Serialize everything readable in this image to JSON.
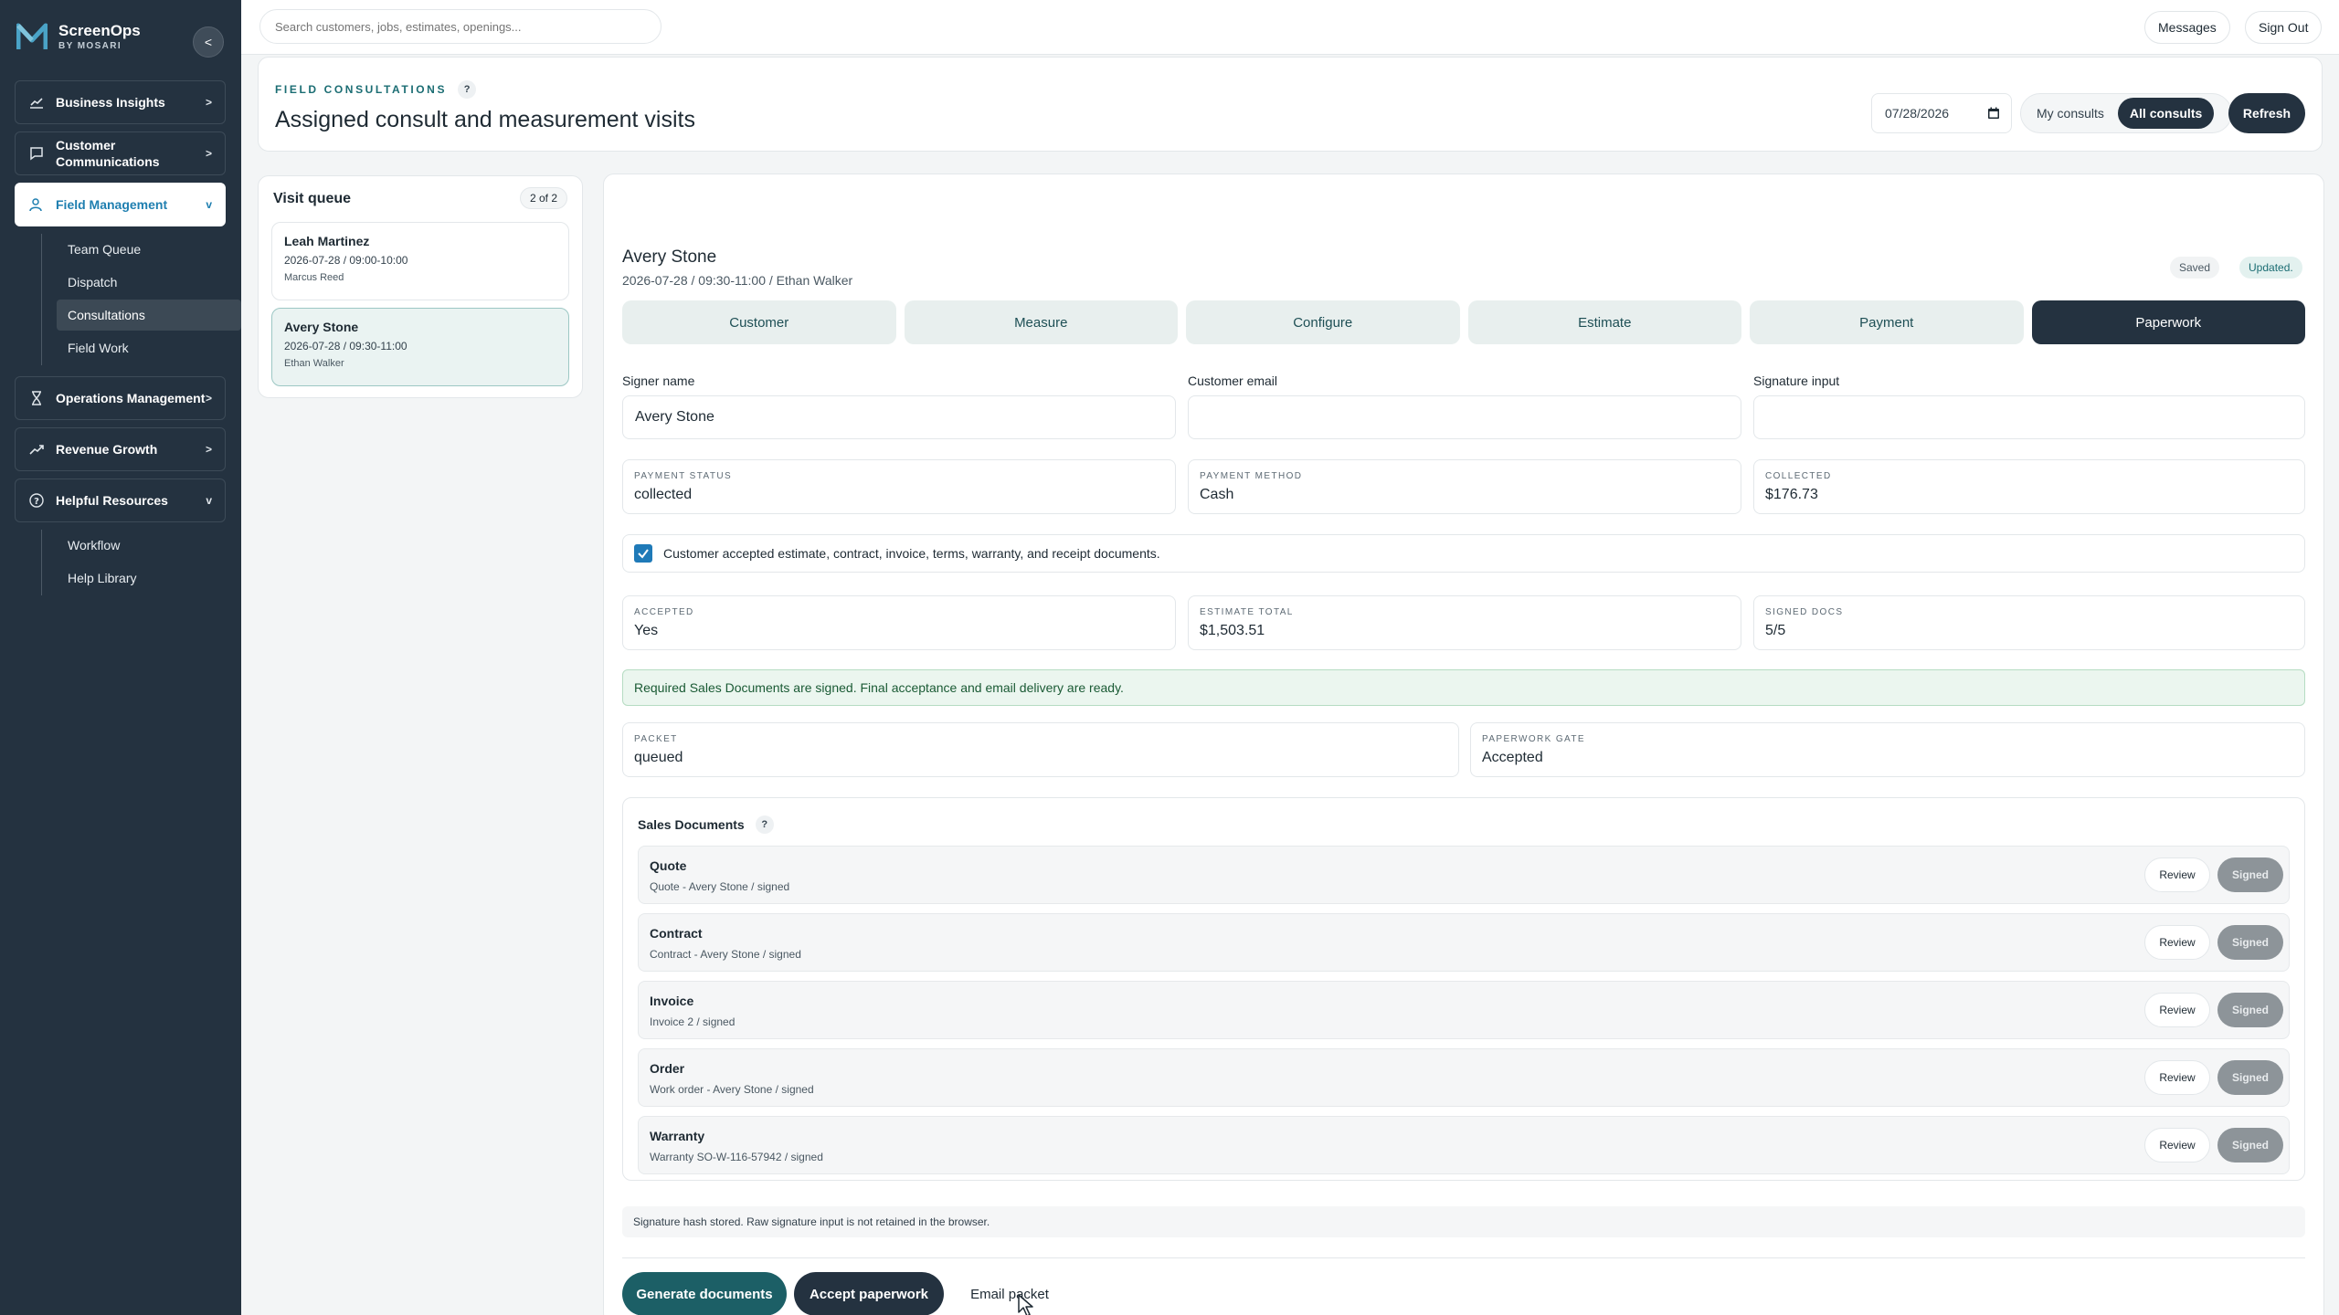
{
  "brand": {
    "name": "ScreenOps",
    "sub": "BY MOSARI"
  },
  "sidebar": {
    "items": [
      {
        "label": "Business Insights",
        "chev": ">"
      },
      {
        "label": "Customer Communications",
        "chev": ">"
      },
      {
        "label": "Field Management",
        "chev": "v"
      },
      {
        "label": "Operations Management",
        "chev": ">"
      },
      {
        "label": "Revenue Growth",
        "chev": ">"
      },
      {
        "label": "Helpful Resources",
        "chev": "v"
      }
    ],
    "field_sub": [
      "Team Queue",
      "Dispatch",
      "Consultations",
      "Field Work"
    ],
    "resources_sub": [
      "Workflow",
      "Help Library"
    ],
    "collapse": "<"
  },
  "topbar": {
    "search_placeholder": "Search customers, jobs, estimates, openings...",
    "messages": "Messages",
    "signout": "Sign Out"
  },
  "header": {
    "eyebrow": "FIELD CONSULTATIONS",
    "help": "?",
    "title": "Assigned consult and measurement visits",
    "date": "07/28/2026",
    "filters": [
      "My consults",
      "All consults"
    ],
    "active_filter": "All consults",
    "refresh": "Refresh"
  },
  "queue": {
    "title": "Visit queue",
    "count": "2 of 2",
    "visits": [
      {
        "name": "Leah Martinez",
        "when": "2026-07-28 / 09:00-10:00",
        "tech": "Marcus Reed"
      },
      {
        "name": "Avery Stone",
        "when": "2026-07-28 / 09:30-11:00",
        "tech": "Ethan Walker"
      }
    ]
  },
  "visit": {
    "name": "Avery Stone",
    "meta": "2026-07-28 / 09:30-11:00 / Ethan Walker",
    "chips": [
      "Saved",
      "Updated."
    ]
  },
  "tabs": [
    "Customer",
    "Measure",
    "Configure",
    "Estimate",
    "Payment",
    "Paperwork"
  ],
  "active_tab": "Paperwork",
  "form": {
    "signer_label": "Signer name",
    "signer_value": "Avery Stone",
    "email_label": "Customer email",
    "email_value": "",
    "signature_label": "Signature input",
    "signature_value": ""
  },
  "payment": {
    "status_k": "PAYMENT STATUS",
    "status_v": "collected",
    "method_k": "PAYMENT METHOD",
    "method_v": "Cash",
    "collected_k": "COLLECTED",
    "collected_v": "$176.73"
  },
  "acceptance": {
    "text": "Customer accepted estimate, contract, invoice, terms, warranty, and receipt documents.",
    "checked": true
  },
  "summary": {
    "accepted_k": "ACCEPTED",
    "accepted_v": "Yes",
    "total_k": "ESTIMATE TOTAL",
    "total_v": "$1,503.51",
    "docs_k": "SIGNED DOCS",
    "docs_v": "5/5"
  },
  "banner": "Required Sales Documents are signed. Final acceptance and email delivery are ready.",
  "packet": {
    "packet_k": "PACKET",
    "packet_v": "queued",
    "gate_k": "PAPERWORK GATE",
    "gate_v": "Accepted"
  },
  "documents": {
    "title": "Sales Documents",
    "help": "?",
    "review_label": "Review",
    "signed_label": "Signed",
    "rows": [
      {
        "name": "Quote",
        "detail": "Quote - Avery Stone / signed"
      },
      {
        "name": "Contract",
        "detail": "Contract - Avery Stone / signed"
      },
      {
        "name": "Invoice",
        "detail": "Invoice 2 / signed"
      },
      {
        "name": "Order",
        "detail": "Work order - Avery Stone / signed"
      },
      {
        "name": "Warranty",
        "detail": "Warranty SO-W-116-57942 / signed"
      }
    ]
  },
  "note": "Signature hash stored. Raw signature input is not retained in the browser.",
  "actions": {
    "generate": "Generate documents",
    "accept": "Accept paperwork",
    "email": "Email packet"
  },
  "colors": {
    "sidebar": "#243240",
    "accent": "#1f7fb0",
    "teal": "#1b6d73",
    "dark_button": "#243240",
    "success_bg": "#ebf6ef"
  }
}
